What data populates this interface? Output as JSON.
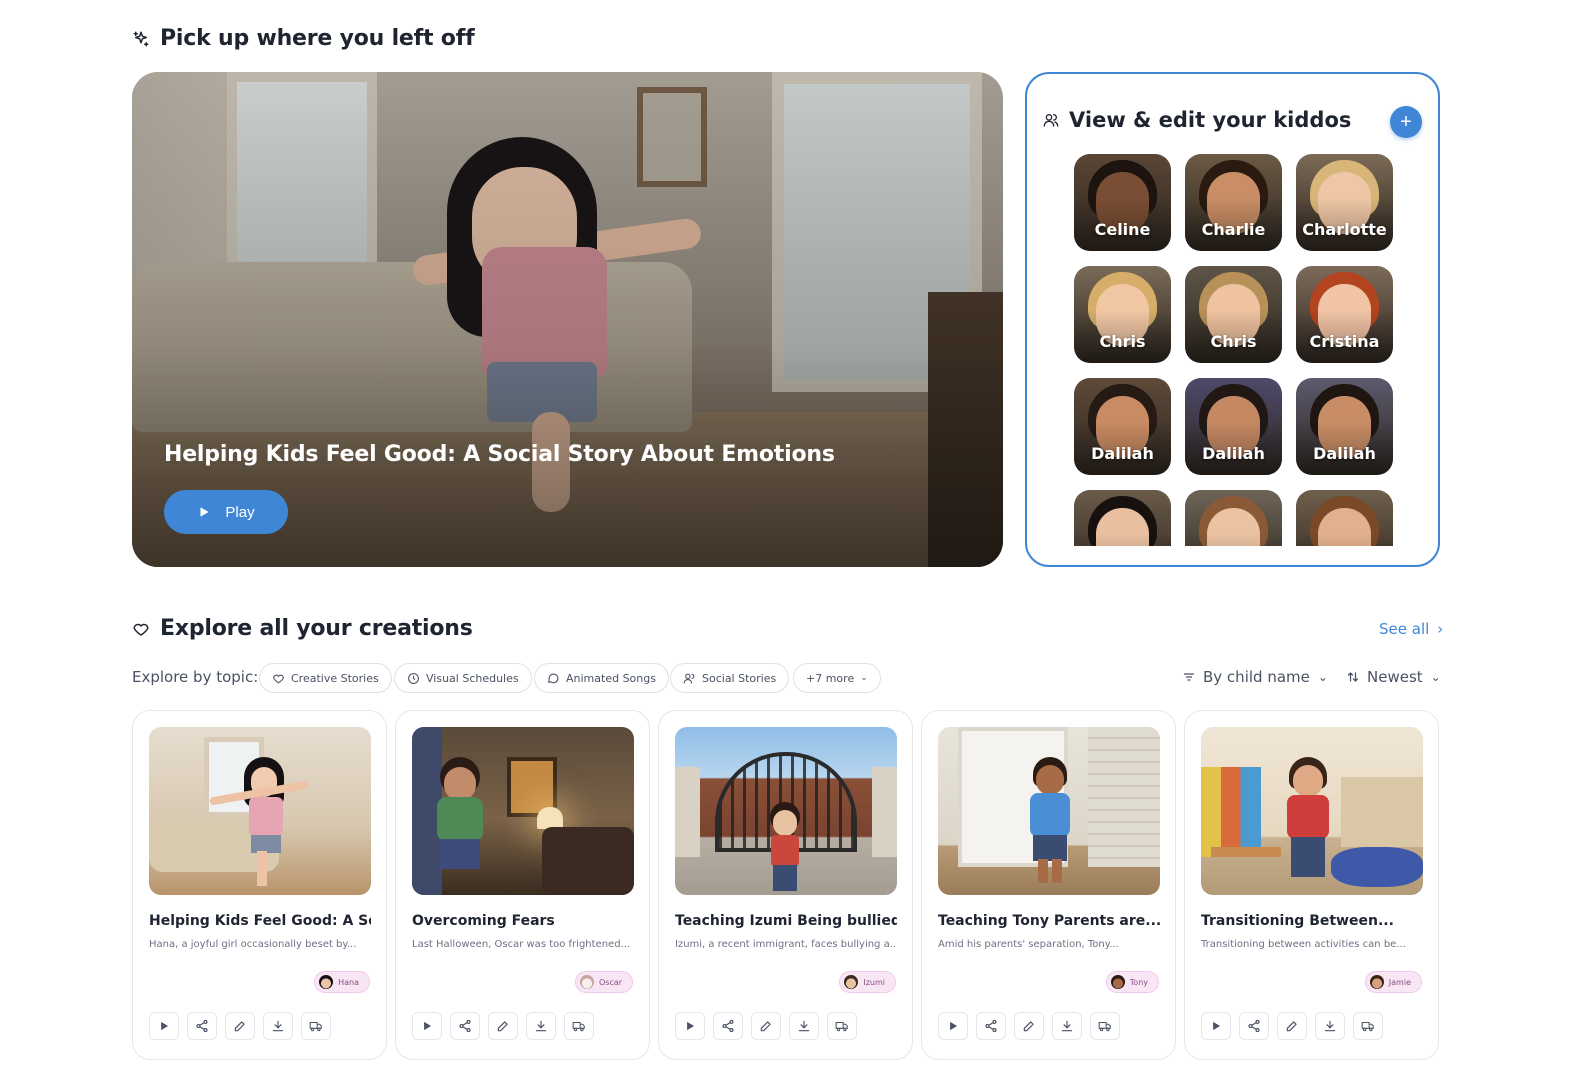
{
  "continue": {
    "heading": "Pick up where you left off",
    "hero_title": "Helping Kids Feel Good: A Social Story About Emotions",
    "play_label": "Play"
  },
  "kiddos": {
    "heading": "View & edit your kiddos",
    "add_icon": "plus-icon",
    "kids": [
      {
        "name": "Celine",
        "bg": "#5a4636",
        "skin": "#7a4e34",
        "hair": "#1d1410"
      },
      {
        "name": "Charlie",
        "bg": "#6b5a44",
        "skin": "#c98e66",
        "hair": "#2a1a10"
      },
      {
        "name": "Charlotte",
        "bg": "#7c6a56",
        "skin": "#f0c7a6",
        "hair": "#d8b679"
      },
      {
        "name": "Chris",
        "bg": "#7a6a58",
        "skin": "#f1c7a4",
        "hair": "#d6ae6a"
      },
      {
        "name": "Chris",
        "bg": "#5f5447",
        "skin": "#efc3a0",
        "hair": "#b89158"
      },
      {
        "name": "Cristina",
        "bg": "#7d6b5a",
        "skin": "#f2c4a6",
        "hair": "#b3441f"
      },
      {
        "name": "Dalilah",
        "bg": "#5e4a3a",
        "skin": "#c98b63",
        "hair": "#251a14"
      },
      {
        "name": "Dalilah",
        "bg": "#4e4a6a",
        "skin": "#c48863",
        "hair": "#211815"
      },
      {
        "name": "Dalilah",
        "bg": "#5c5a6e",
        "skin": "#c88d66",
        "hair": "#1f1612"
      },
      {
        "name": "",
        "bg": "#6a5a4a",
        "skin": "#e9bf9f",
        "hair": "#16110f"
      },
      {
        "name": "",
        "bg": "#6e6456",
        "skin": "#ebc2a2",
        "hair": "#8a5a36"
      },
      {
        "name": "",
        "bg": "#6f5f4c",
        "skin": "#e2b08c",
        "hair": "#7a4a28"
      }
    ]
  },
  "explore": {
    "heading": "Explore all your creations",
    "see_all": "See all",
    "topic_label": "Explore by topic:",
    "chips": [
      "Creative Stories",
      "Visual Schedules",
      "Animated Songs",
      "Social Stories",
      "+7 more"
    ],
    "filter_label": "By child name",
    "sort_label": "Newest"
  },
  "cards": [
    {
      "title": "Helping Kids Feel Good: A Soci...",
      "desc": "Hana, a joyful girl occasionally beset by...",
      "tag": "Hana",
      "tag_skin": "#eec2a5",
      "tag_hair": "#141013"
    },
    {
      "title": "Overcoming Fears",
      "desc": "Last Halloween, Oscar was too frightened...",
      "tag": "Oscar",
      "tag_skin": "#f7f2ef",
      "tag_hair": "#c9a7a0"
    },
    {
      "title": "Teaching Izumi Being bullied",
      "desc": "Izumi, a recent immigrant, faces bullying a...",
      "tag": "Izumi",
      "tag_skin": "#e7c3a2",
      "tag_hair": "#3a2a22"
    },
    {
      "title": "Teaching Tony Parents are...",
      "desc": "Amid his parents' separation, Tony...",
      "tag": "Tony",
      "tag_skin": "#a86b48",
      "tag_hair": "#2a1a12"
    },
    {
      "title": "Transitioning Between...",
      "desc": "Transitioning between activities can be...",
      "tag": "Jamie",
      "tag_skin": "#d8a07c",
      "tag_hair": "#3a2418"
    }
  ]
}
